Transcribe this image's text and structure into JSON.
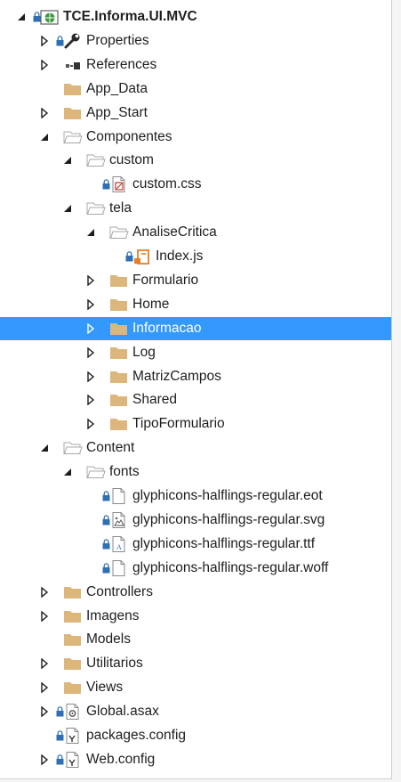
{
  "panel": "solution-explorer",
  "colors": {
    "selection": "#3399ff",
    "folder": "#dcb67a",
    "lock": "#2f6fb4",
    "js": "#e67e22"
  },
  "tree": [
    {
      "label": "TCE.Informa.UI.MVC",
      "depth": 0,
      "expander": "expanded",
      "icon": "web-project-icon",
      "lock": true,
      "bold": true
    },
    {
      "label": "Properties",
      "depth": 1,
      "expander": "collapsed",
      "icon": "wrench-icon",
      "lock": true
    },
    {
      "label": "References",
      "depth": 1,
      "expander": "collapsed",
      "icon": "references-icon",
      "lock": false
    },
    {
      "label": "App_Data",
      "depth": 1,
      "expander": "none",
      "icon": "folder-icon",
      "lock": false
    },
    {
      "label": "App_Start",
      "depth": 1,
      "expander": "collapsed",
      "icon": "folder-icon",
      "lock": false
    },
    {
      "label": "Componentes",
      "depth": 1,
      "expander": "expanded",
      "icon": "folder-open-icon",
      "lock": false
    },
    {
      "label": "custom",
      "depth": 2,
      "expander": "expanded",
      "icon": "folder-open-icon",
      "lock": false
    },
    {
      "label": "custom.css",
      "depth": 3,
      "expander": "none",
      "icon": "css-file-icon",
      "lock": true
    },
    {
      "label": "tela",
      "depth": 2,
      "expander": "expanded",
      "icon": "folder-open-icon",
      "lock": false
    },
    {
      "label": "AnaliseCritica",
      "depth": 3,
      "expander": "expanded",
      "icon": "folder-open-icon",
      "lock": false
    },
    {
      "label": "Index.js",
      "depth": 4,
      "expander": "none",
      "icon": "js-file-icon",
      "lock": true
    },
    {
      "label": "Formulario",
      "depth": 3,
      "expander": "collapsed",
      "icon": "folder-icon",
      "lock": false
    },
    {
      "label": "Home",
      "depth": 3,
      "expander": "collapsed",
      "icon": "folder-icon",
      "lock": false
    },
    {
      "label": "Informacao",
      "depth": 3,
      "expander": "collapsed",
      "icon": "folder-icon",
      "lock": false,
      "selected": true
    },
    {
      "label": "Log",
      "depth": 3,
      "expander": "collapsed",
      "icon": "folder-icon",
      "lock": false
    },
    {
      "label": "MatrizCampos",
      "depth": 3,
      "expander": "collapsed",
      "icon": "folder-icon",
      "lock": false
    },
    {
      "label": "Shared",
      "depth": 3,
      "expander": "collapsed",
      "icon": "folder-icon",
      "lock": false
    },
    {
      "label": "TipoFormulario",
      "depth": 3,
      "expander": "collapsed",
      "icon": "folder-icon",
      "lock": false
    },
    {
      "label": "Content",
      "depth": 1,
      "expander": "expanded",
      "icon": "folder-open-icon",
      "lock": false
    },
    {
      "label": "fonts",
      "depth": 2,
      "expander": "expanded",
      "icon": "folder-open-icon",
      "lock": false
    },
    {
      "label": "glyphicons-halflings-regular.eot",
      "depth": 3,
      "expander": "none",
      "icon": "file-icon",
      "lock": true
    },
    {
      "label": "glyphicons-halflings-regular.svg",
      "depth": 3,
      "expander": "none",
      "icon": "image-file-icon",
      "lock": true
    },
    {
      "label": "glyphicons-halflings-regular.ttf",
      "depth": 3,
      "expander": "none",
      "icon": "font-file-icon",
      "lock": true
    },
    {
      "label": "glyphicons-halflings-regular.woff",
      "depth": 3,
      "expander": "none",
      "icon": "file-icon",
      "lock": true
    },
    {
      "label": "Controllers",
      "depth": 1,
      "expander": "collapsed",
      "icon": "folder-icon",
      "lock": false
    },
    {
      "label": "Imagens",
      "depth": 1,
      "expander": "collapsed",
      "icon": "folder-icon",
      "lock": false
    },
    {
      "label": "Models",
      "depth": 1,
      "expander": "none",
      "icon": "folder-icon",
      "lock": false
    },
    {
      "label": "Utilitarios",
      "depth": 1,
      "expander": "collapsed",
      "icon": "folder-icon",
      "lock": false
    },
    {
      "label": "Views",
      "depth": 1,
      "expander": "collapsed",
      "icon": "folder-icon",
      "lock": false
    },
    {
      "label": "Global.asax",
      "depth": 1,
      "expander": "collapsed",
      "icon": "asax-file-icon",
      "lock": true
    },
    {
      "label": "packages.config",
      "depth": 1,
      "expander": "none",
      "icon": "config-file-icon",
      "lock": true
    },
    {
      "label": "Web.config",
      "depth": 1,
      "expander": "collapsed",
      "icon": "config-file-icon",
      "lock": true
    }
  ]
}
